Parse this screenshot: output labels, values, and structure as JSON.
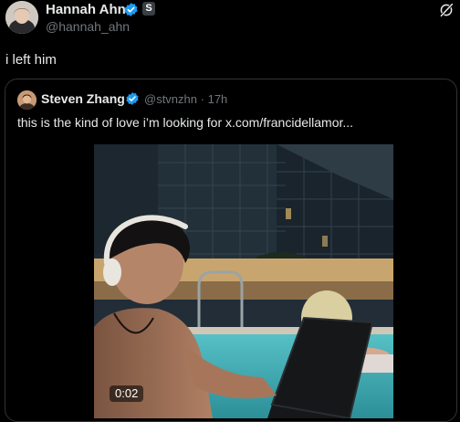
{
  "tweet": {
    "author_name": "Hannah Ahn",
    "author_handle": "@hannah_ahn",
    "badge_letter": "S",
    "text": "i left him"
  },
  "quoted_tweet": {
    "author_name": "Steven Zhang",
    "author_handle": "@stvnzhn",
    "separator": "·",
    "time": "17h",
    "text": "this is the kind of love i’m looking for  x.com/francidellamor...",
    "video": {
      "timestamp": "0:02"
    }
  },
  "icons": {
    "verified": "verified-check-icon",
    "grok": "grok-icon"
  },
  "colors": {
    "background": "#000000",
    "text_primary": "#e7e9ea",
    "text_secondary": "#71767b",
    "verified_blue": "#1d9bf0",
    "card_border": "#2f3336"
  }
}
